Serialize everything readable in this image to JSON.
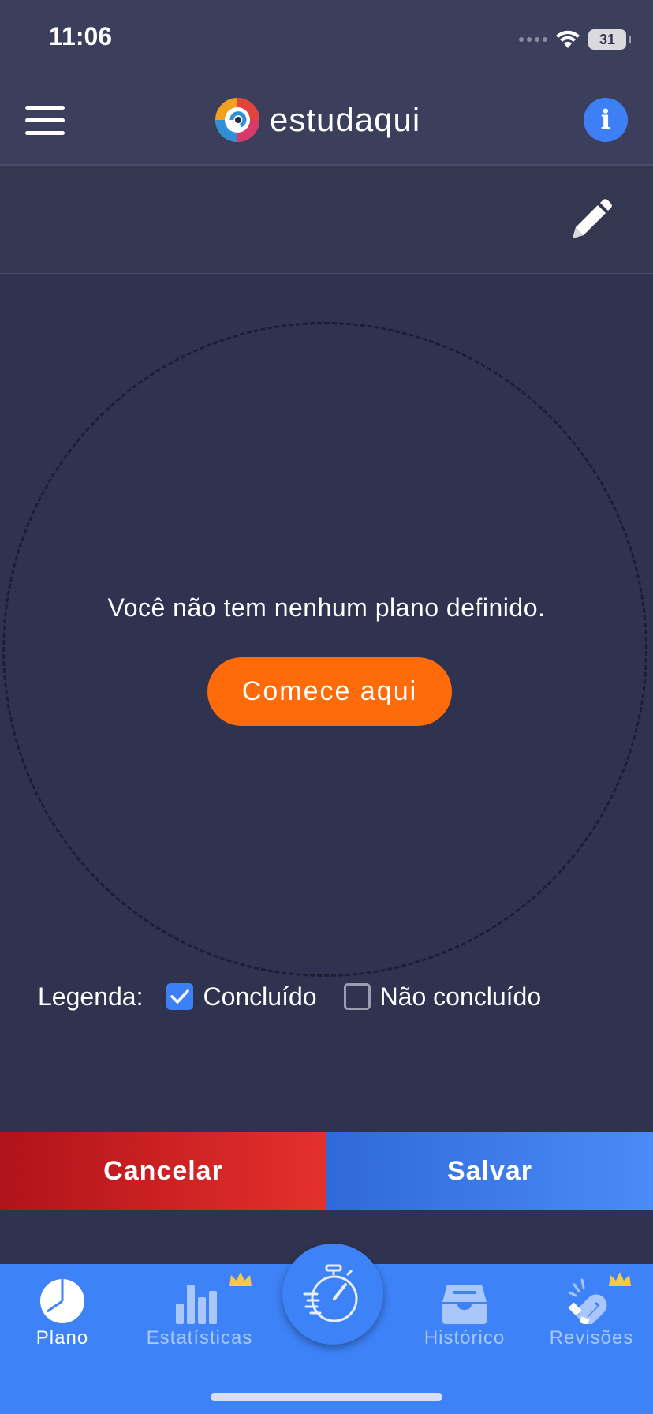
{
  "status_bar": {
    "time": "11:06",
    "battery": "31"
  },
  "header": {
    "brand_name": "estudaqui",
    "info_label": "i"
  },
  "plan": {
    "empty_message": "Você não tem nenhum plano definido.",
    "start_label": "Comece aqui"
  },
  "legend": {
    "label": "Legenda:",
    "completed": "Concluído",
    "not_completed": "Não concluído"
  },
  "actions": {
    "cancel_label": "Cancelar",
    "save_label": "Salvar"
  },
  "tabs": [
    {
      "label": "Plano",
      "icon": "pie-chart-icon"
    },
    {
      "label": "Estatísticas",
      "icon": "bar-chart-icon"
    },
    {
      "label": "",
      "icon": "stopwatch-icon"
    },
    {
      "label": "Histórico",
      "icon": "archive-box-icon"
    },
    {
      "label": "Revisões",
      "icon": "magnet-icon"
    }
  ],
  "colors": {
    "background": "#2f3350",
    "header": "#3b3f5c",
    "accent_orange": "#ff6b0a",
    "tab_blue": "#3d82f6",
    "cancel_red": "#d32125",
    "save_blue": "#3d7ff5",
    "crown_gold": "#f7c948"
  }
}
